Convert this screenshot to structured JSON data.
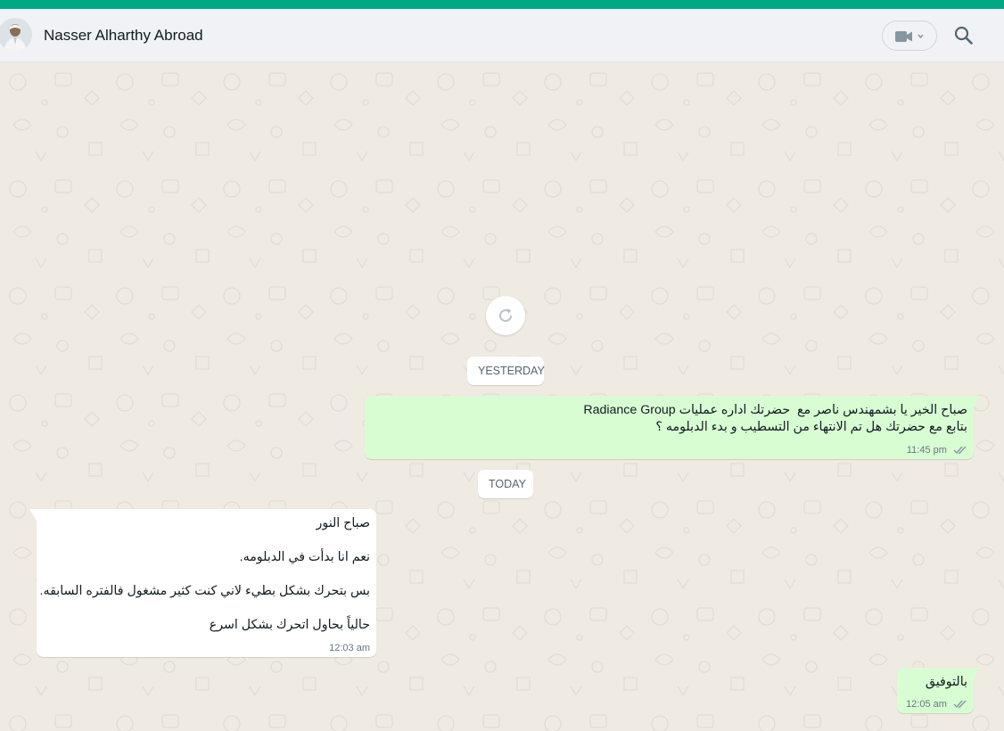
{
  "header": {
    "contact_name": "Nasser Alharthy Abroad",
    "icons": {
      "video": "video-camera-icon",
      "dropdown": "chevron-down-icon",
      "search": "search-icon"
    }
  },
  "colors": {
    "accent": "#00a884",
    "outgoing_bubble": "#d9fdd3",
    "incoming_bubble": "#ffffff",
    "chat_background": "#efeae2",
    "ticks": "#8696a0"
  },
  "chat": {
    "reload_icon": "refresh-icon",
    "date_yesterday": "YESTERDAY",
    "date_today": "TODAY",
    "messages": [
      {
        "direction": "outgoing",
        "text": "صباح الخير يا بشمهندس ناصر مع  حضرتك اداره عمليات Radiance Group\nبتابع مع حضرتك هل تم الانتهاء من التسطيب و بدء الدبلومه ؟",
        "time": "11:45 pm",
        "status": "delivered"
      },
      {
        "direction": "incoming",
        "text": "صباح النور\n\nنعم انا بدأت في الدبلومه.\n\nبس بتحرك بشكل بطيء لاني كنت كثير مشغول فالفتره السابقه.\n\nحالياً بحاول اتحرك بشكل اسرع",
        "time": "12:03 am"
      },
      {
        "direction": "outgoing",
        "text": "بالتوفيق",
        "time": "12:05 am",
        "status": "delivered"
      }
    ]
  }
}
